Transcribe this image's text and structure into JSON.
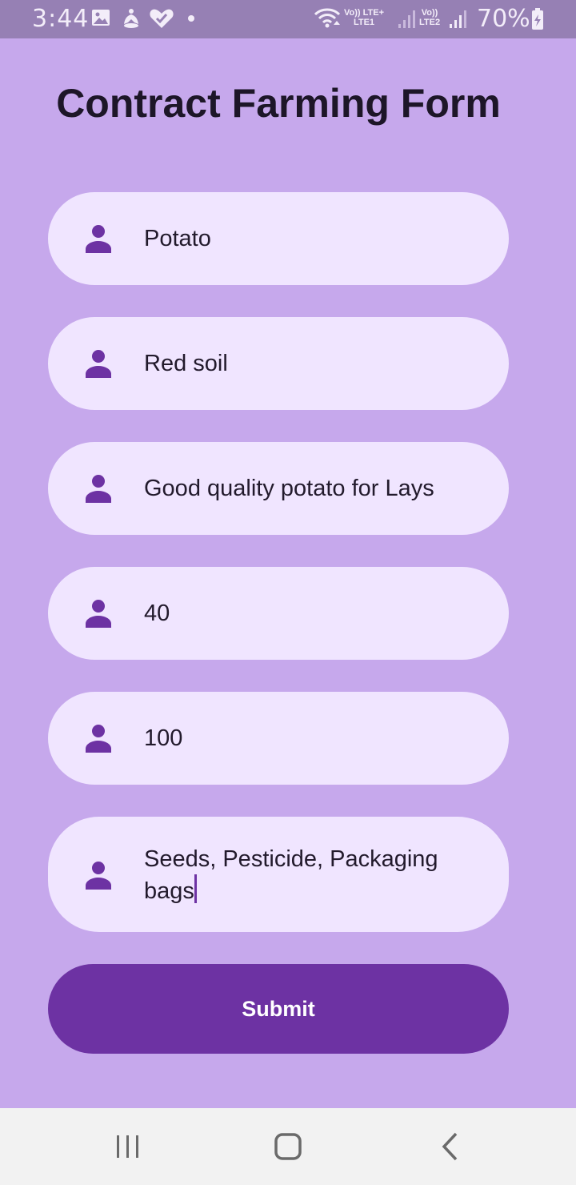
{
  "status_bar": {
    "time": "3:44",
    "sim1_label_top": "Vo)) LTE+",
    "sim1_label_bottom": "LTE1",
    "sim2_label_top": "Vo))",
    "sim2_label_bottom": "LTE2",
    "battery": "70%",
    "icons": [
      "gallery-icon",
      "yoga-icon",
      "heart-icon",
      "dot-icon",
      "wifi-icon",
      "signal-icon",
      "battery-icon"
    ]
  },
  "form": {
    "title": "Contract Farming Form",
    "fields": [
      {
        "value": "Potato",
        "icon": "person-icon"
      },
      {
        "value": "Red soil",
        "icon": "person-icon"
      },
      {
        "value": "Good quality potato for Lays",
        "icon": "person-icon"
      },
      {
        "value": "40",
        "icon": "person-icon"
      },
      {
        "value": "100",
        "icon": "person-icon"
      },
      {
        "value_line1": "Seeds, Pesticide, Packaging",
        "value_line2": "bags",
        "icon": "person-icon"
      }
    ],
    "submit_label": "Submit"
  },
  "colors": {
    "background": "#c6a8ec",
    "field_background": "#f0e5ff",
    "accent": "#6d32a3",
    "status_bar": "#9680b4",
    "nav_bar": "#f2f2f2"
  },
  "nav_bar": {
    "buttons": [
      "recent-apps-icon",
      "home-icon",
      "back-icon"
    ]
  }
}
